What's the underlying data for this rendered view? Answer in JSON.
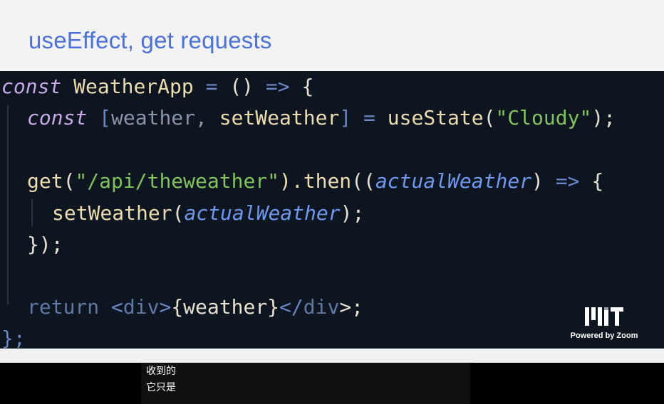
{
  "slide": {
    "title": "useEffect, get requests"
  },
  "code": {
    "line1": {
      "const": "const",
      "name": "WeatherApp",
      "eq": "=",
      "parens": "()",
      "arrow": "=>",
      "brace": "{"
    },
    "line2": {
      "const": "const",
      "open": "[",
      "weather": "weather,",
      "setter": "setWeather",
      "close": "]",
      "eq": "=",
      "hook": "useState",
      "lp": "(",
      "str": "\"Cloudy\"",
      "rp": ");"
    },
    "line4": {
      "get": "get",
      "lp": "(",
      "str": "\"/api/theweather\"",
      "then": ").then",
      "lp2": "((",
      "param": "actualWeather",
      "rp": ")",
      "arrow": "=>",
      "brace": "{"
    },
    "line5": {
      "setter": "setWeather",
      "lp": "(",
      "param": "actualWeather",
      "rp": ");"
    },
    "line6": {
      "close": "});"
    },
    "line8": {
      "ret": "return",
      "lt": "<",
      "div": "div",
      "gt": ">",
      "expr": "{weather}",
      "lt2": "</",
      "div2": "div",
      "gt2": ">;"
    },
    "line9": {
      "close": "};"
    }
  },
  "branding": {
    "powered": "Powered by Zoom"
  },
  "subtitles": {
    "line1": "收到的",
    "line2": "它只是"
  },
  "colors": {
    "title": "#4a72d8",
    "code_bg": "#0d1521",
    "keyword": "#c6a9e6",
    "function": "#ecdcae",
    "string": "#7fc45d",
    "parameter": "#6e99f0",
    "operator": "#6b86c7"
  }
}
